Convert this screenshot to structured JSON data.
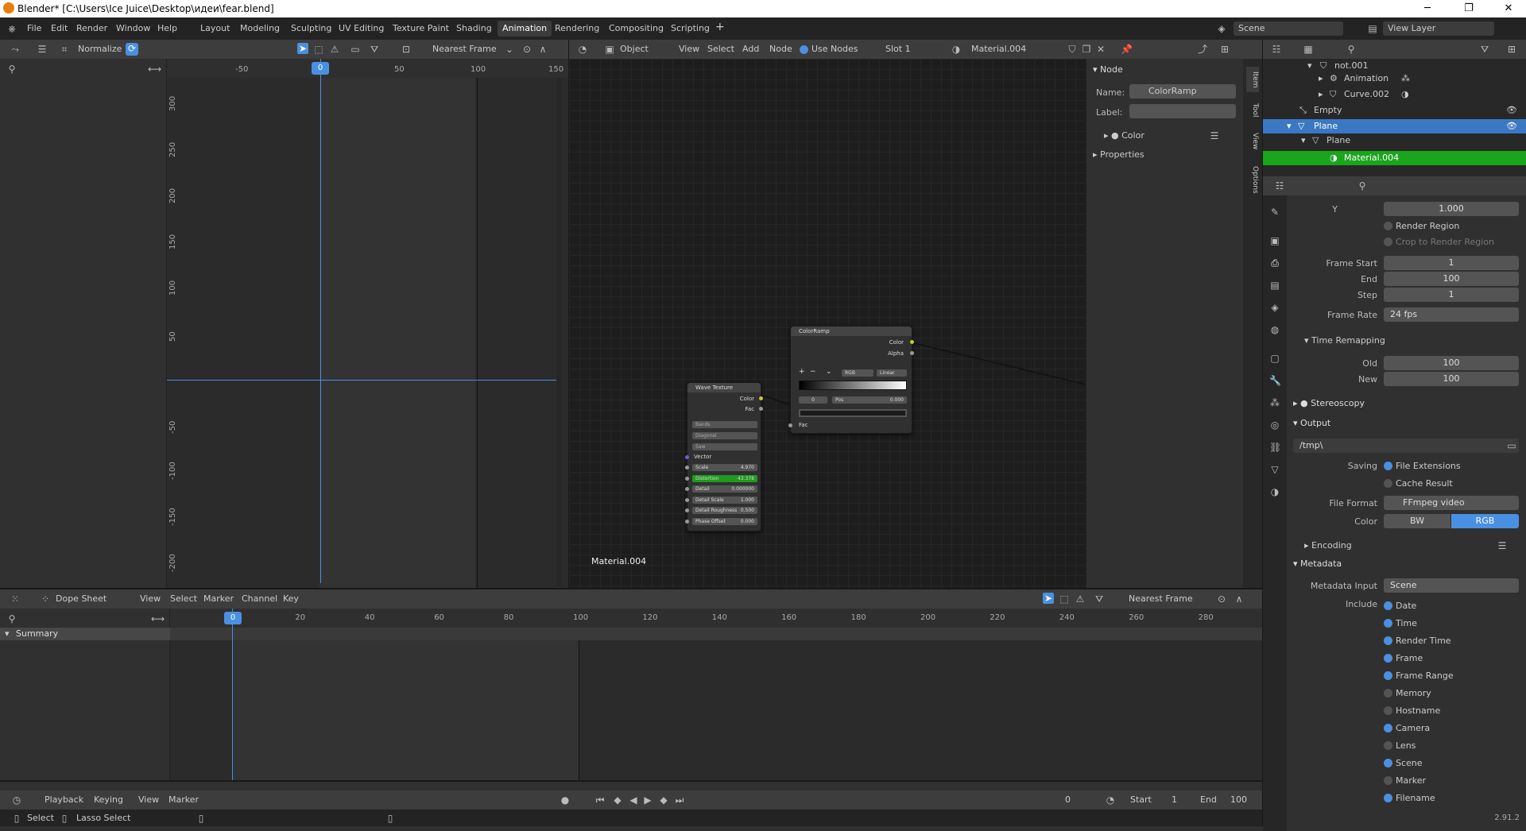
{
  "title": "Blender* [C:\\Users\\Ice Juice\\Desktop\\идеи\\fear.blend]",
  "menus": [
    "File",
    "Edit",
    "Render",
    "Window",
    "Help"
  ],
  "workspaces": [
    "Layout",
    "Modeling",
    "Sculpting",
    "UV Editing",
    "Texture Paint",
    "Shading",
    "Animation",
    "Rendering",
    "Compositing",
    "Scripting"
  ],
  "active_workspace": "Animation",
  "scene": "Scene",
  "view_layer": "View Layer",
  "graph": {
    "normalize": "Normalize",
    "snap": "Nearest Frame",
    "x_ticks": [
      "-50",
      "0",
      "50",
      "100",
      "150"
    ],
    "y_ticks": [
      "300",
      "250",
      "200",
      "150",
      "100",
      "50",
      "0",
      "-50",
      "-100",
      "-150",
      "-200"
    ],
    "current_frame": "0"
  },
  "node_editor": {
    "editor_mode": "Object",
    "menus": [
      "View",
      "Select",
      "Add",
      "Node"
    ],
    "use_nodes": "Use Nodes",
    "slot": "Slot 1",
    "material": "Material.004",
    "material_label": "Material.004"
  },
  "node_sidebar": {
    "header": "Node",
    "name_label": "Name:",
    "name_value": "ColorRamp",
    "label_label": "Label:",
    "color": "Color",
    "properties": "Properties",
    "tabs": [
      "Item",
      "Tool",
      "View",
      "Options"
    ]
  },
  "colorramp": {
    "title": "ColorRamp",
    "out_color": "Color",
    "out_alpha": "Alpha",
    "mode": "RGB",
    "interp": "Linear",
    "index": "0",
    "pos_label": "Pos",
    "pos_value": "0.000",
    "in_fac": "Fac"
  },
  "wave": {
    "title": "Wave Texture",
    "out_color": "Color",
    "out_fac": "Fac",
    "type": "Bands",
    "direction": "Diagonal",
    "profile": "Saw",
    "vector": "Vector",
    "scale_label": "Scale",
    "scale_value": "4.970",
    "distortion_label": "Distortion",
    "distortion_value": "43.378",
    "detail_label": "Detail",
    "detail_value": "0.000000",
    "detail_scale_label": "Detail Scale",
    "detail_scale_value": "1.000",
    "detail_rough_label": "Detail Roughness",
    "detail_rough_value": "0.500",
    "phase_label": "Phase Offset",
    "phase_value": "0.000"
  },
  "outliner": {
    "items": [
      {
        "label": "not.001"
      },
      {
        "label": "Animation"
      },
      {
        "label": "Curve.002"
      },
      {
        "label": "Empty"
      },
      {
        "label": "Plane"
      },
      {
        "label": "Plane"
      },
      {
        "label": "Material.004"
      }
    ]
  },
  "props": {
    "y_label": "Y",
    "y_value": "1.000",
    "render_region": "Render Region",
    "crop": "Crop to Render Region",
    "frame_start_label": "Frame Start",
    "frame_start": "1",
    "end_label": "End",
    "end": "100",
    "step_label": "Step",
    "step": "1",
    "frame_rate_label": "Frame Rate",
    "frame_rate": "24 fps",
    "time_remap": "Time Remapping",
    "old_label": "Old",
    "old": "100",
    "new_label": "New",
    "new": "100",
    "stereoscopy": "Stereoscopy",
    "output": "Output",
    "path": "/tmp\\",
    "saving_label": "Saving",
    "file_ext": "File Extensions",
    "cache": "Cache Result",
    "format_label": "File Format",
    "format": "FFmpeg video",
    "color_label": "Color",
    "bw": "BW",
    "rgb": "RGB",
    "encoding": "Encoding",
    "metadata": "Metadata",
    "meta_input_label": "Metadata Input",
    "meta_input": "Scene",
    "include_label": "Include",
    "include": [
      {
        "label": "Date",
        "on": true
      },
      {
        "label": "Time",
        "on": true
      },
      {
        "label": "Render Time",
        "on": true
      },
      {
        "label": "Frame",
        "on": true
      },
      {
        "label": "Frame Range",
        "on": true
      },
      {
        "label": "Memory",
        "on": false
      },
      {
        "label": "Hostname",
        "on": false
      },
      {
        "label": "Camera",
        "on": true
      },
      {
        "label": "Lens",
        "on": false
      },
      {
        "label": "Scene",
        "on": true
      },
      {
        "label": "Marker",
        "on": false
      },
      {
        "label": "Filename",
        "on": true
      }
    ]
  },
  "dopesheet": {
    "mode": "Dope Sheet",
    "menus": [
      "View",
      "Select",
      "Marker",
      "Channel",
      "Key"
    ],
    "snap": "Nearest Frame",
    "summary": "Summary",
    "ticks": [
      "0",
      "20",
      "40",
      "60",
      "80",
      "100",
      "120",
      "140",
      "160",
      "180",
      "200",
      "220",
      "240",
      "260",
      "280"
    ]
  },
  "timeline": {
    "menus": [
      "Playback",
      "Keying",
      "View",
      "Marker"
    ],
    "frame": "0",
    "start_label": "Start",
    "start": "1",
    "end_label": "End",
    "end": "100"
  },
  "status": {
    "select": "Select",
    "lasso": "Lasso Select",
    "version": "2.91.2"
  }
}
